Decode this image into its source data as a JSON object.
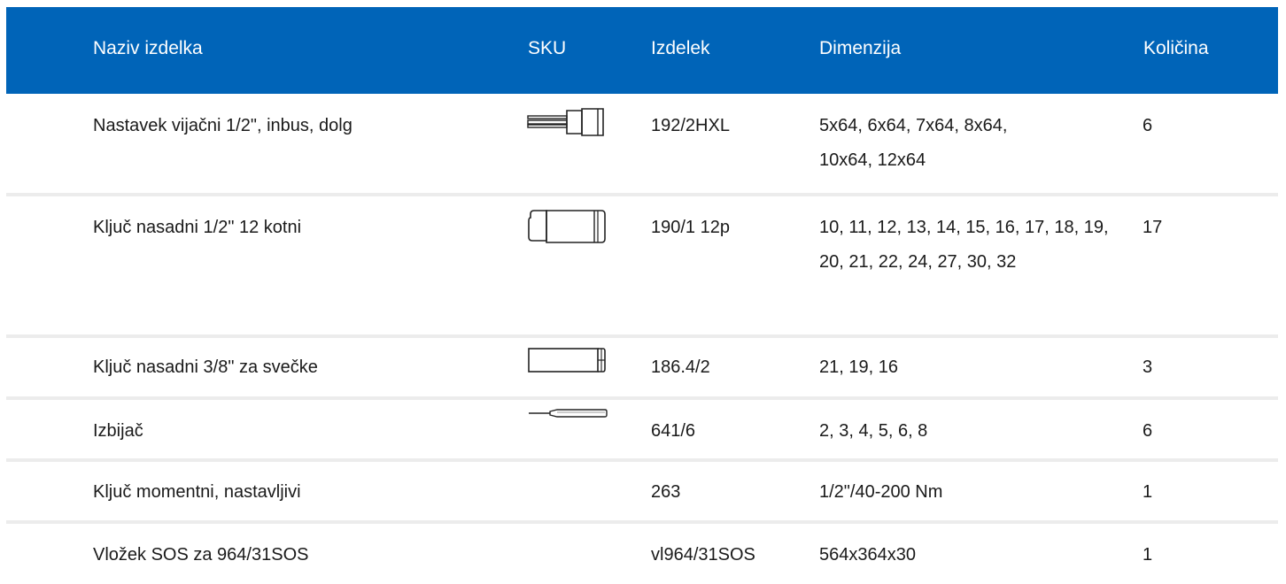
{
  "columns": {
    "name": "Naziv izdelka",
    "sku": "SKU",
    "item": "Izdelek",
    "dimension": "Dimenzija",
    "quantity": "Količina"
  },
  "colors": {
    "header_bg": "#0064b8",
    "header_text": "#ffffff",
    "row_divider": "#ececec"
  },
  "rows": [
    {
      "name": "Nastavek vijačni 1/2\", inbus, dolg",
      "sku_icon": "hex-bit-socket-icon",
      "item": "192/2HXL",
      "dimension": "5x64, 6x64, 7x64, 8x64, 10x64, 12x64",
      "quantity": "6"
    },
    {
      "name": "Ključ nasadni 1/2\" 12 kotni",
      "sku_icon": "socket-icon",
      "item": "190/1 12p",
      "dimension": "10, 11, 12, 13, 14, 15, 16, 17, 18, 19, 20, 21, 22, 24, 27, 30, 32",
      "quantity": "17"
    },
    {
      "name": "Ključ nasadni 3/8\" za svečke",
      "sku_icon": "spark-plug-socket-icon",
      "item": "186.4/2",
      "dimension": "21, 19, 16",
      "quantity": "3"
    },
    {
      "name": "Izbijač",
      "sku_icon": "pin-punch-icon",
      "item": "641/6",
      "dimension": "2, 3, 4, 5, 6, 8",
      "quantity": "6"
    },
    {
      "name": "Ključ momentni, nastavljivi",
      "sku_icon": "",
      "item": "263",
      "dimension": "1/2\"/40-200 Nm",
      "quantity": "1"
    },
    {
      "name": "Vložek SOS za 964/31SOS",
      "sku_icon": "",
      "item": "vl964/31SOS",
      "dimension": "564x364x30",
      "quantity": "1"
    }
  ]
}
